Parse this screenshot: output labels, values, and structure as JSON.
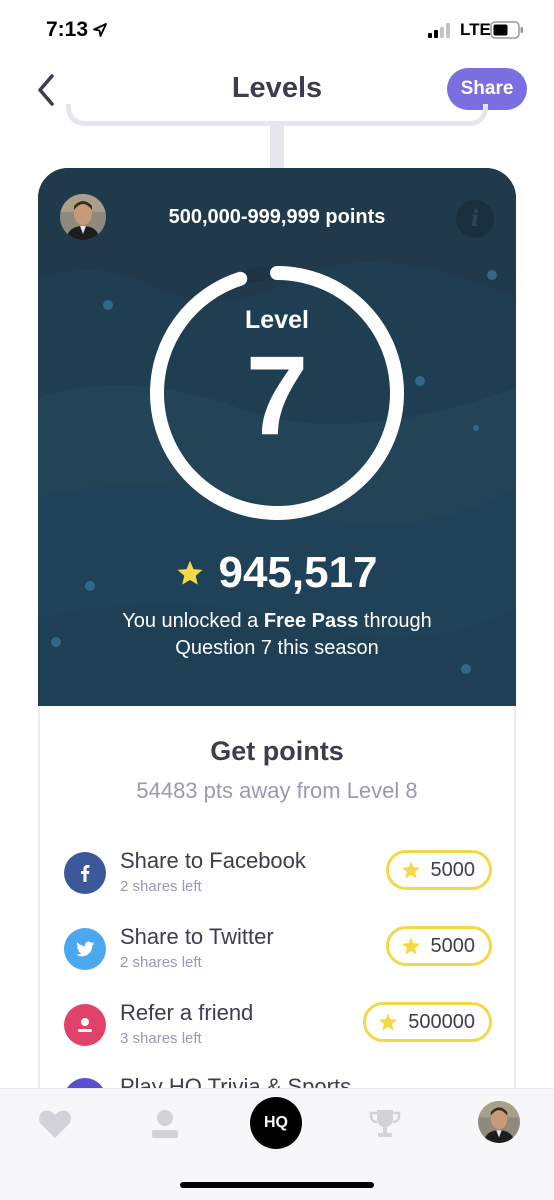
{
  "status_bar": {
    "time": "7:13",
    "network": "LTE",
    "icons": [
      "location-arrow-icon",
      "signal-bars-icon",
      "battery-icon"
    ]
  },
  "header": {
    "title": "Levels",
    "back_icon": "chevron-left-icon",
    "share_label": "Share"
  },
  "level_card": {
    "range": "500,000-999,999 points",
    "info_icon_text": "i",
    "level_label": "Level",
    "level_number": "7",
    "progress_fraction": 0.95,
    "points": "945,517",
    "unlock_prefix": "You unlocked a ",
    "unlock_bold": "Free Pass",
    "unlock_suffix": " through",
    "unlock_line2": "Question 7 this season"
  },
  "get_points": {
    "title": "Get points",
    "away": "54483 pts away from Level 8",
    "tasks": [
      {
        "label": "Share to Facebook",
        "sub": "2 shares left",
        "reward": "5000",
        "icon": "facebook-icon",
        "color": "#3b5998"
      },
      {
        "label": "Share to Twitter",
        "sub": "2 shares left",
        "reward": "5000",
        "icon": "twitter-icon",
        "color": "#4aa8ee"
      },
      {
        "label": "Refer a friend",
        "sub": "3 shares left",
        "reward": "500000",
        "icon": "person-icon",
        "color": "#e0426a"
      },
      {
        "label": "Play HQ Trivia & Sports",
        "icon": "hq-icon",
        "color": "#5a4fcf"
      }
    ]
  },
  "tabbar": {
    "hq_label": "HQ",
    "icons": [
      "heart-icon",
      "profile-icon",
      "hq-logo",
      "trophy-icon",
      "avatar"
    ]
  },
  "colors": {
    "accent": "#7a6ee0",
    "card": "#203a4c",
    "star": "#f3d84a"
  }
}
